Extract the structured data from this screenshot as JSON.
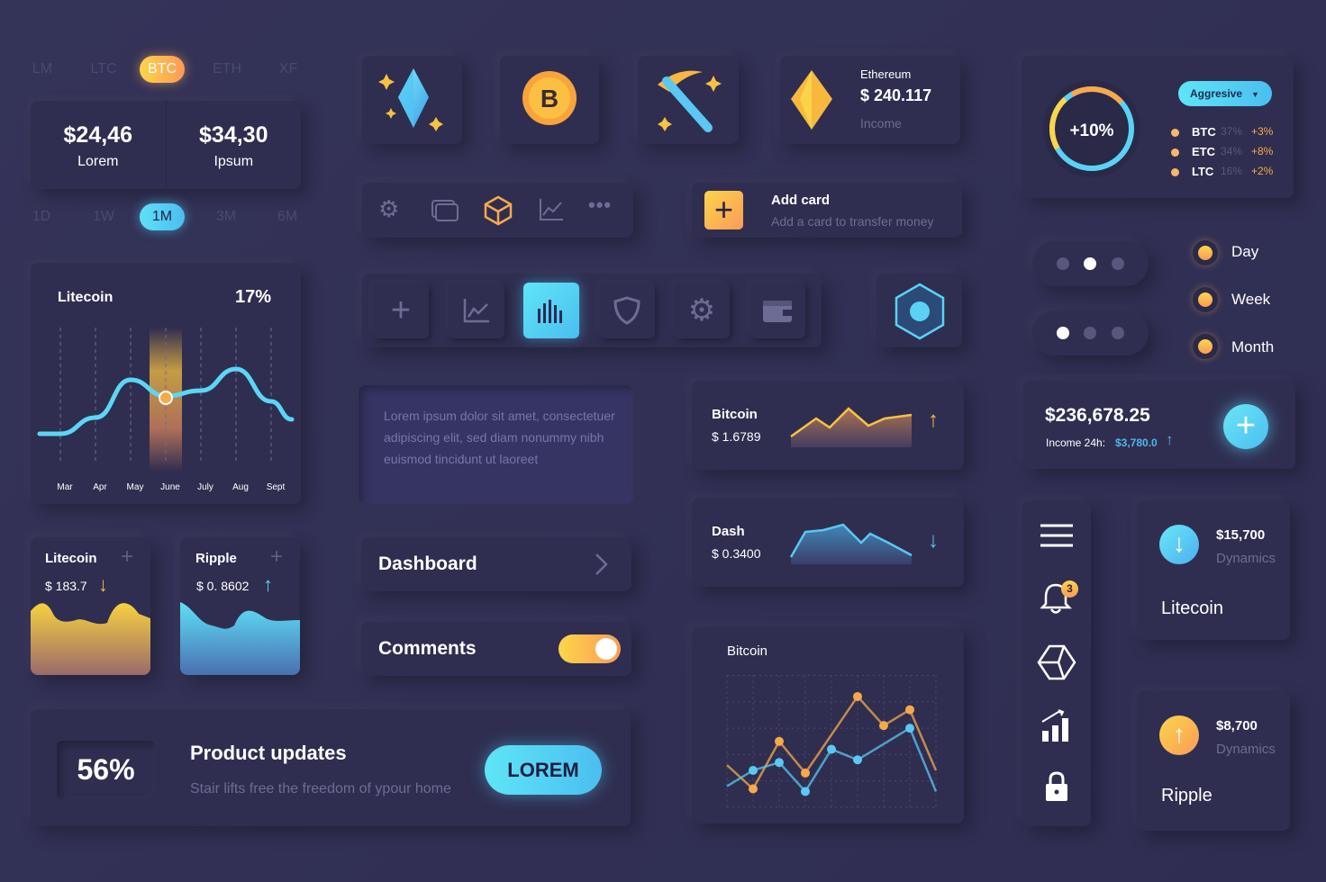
{
  "coin_tabs": {
    "items": [
      "LM",
      "LTC",
      "BTC",
      "ETH",
      "XF"
    ],
    "active": "BTC"
  },
  "prices": [
    {
      "value": "$24,46",
      "label": "Lorem"
    },
    {
      "value": "$34,30",
      "label": "Ipsum"
    }
  ],
  "period_tabs": {
    "items": [
      "1D",
      "1W",
      "1M",
      "3M",
      "6M"
    ],
    "active": "1M"
  },
  "litecoin_chart": {
    "title": "Litecoin",
    "percent": "17%"
  },
  "chart_data": [
    {
      "type": "line",
      "title": "Litecoin",
      "categories": [
        "Mar",
        "Apr",
        "May",
        "June",
        "July",
        "Aug",
        "Sept"
      ],
      "values": [
        1.0,
        1.6,
        3.0,
        2.4,
        2.6,
        3.4,
        2.2
      ],
      "highlight": "June",
      "grid": true,
      "colors": {
        "line": "#5cd6f5",
        "highlight": "#f7b548"
      }
    },
    {
      "type": "line",
      "title": "Bitcoin",
      "x": [
        0,
        1,
        2,
        3,
        4,
        5,
        6,
        7,
        8
      ],
      "series": [
        {
          "values": [
            1.6,
            0.7,
            2.5,
            1.3,
            null,
            4.2,
            3.1,
            3.7,
            1.4
          ],
          "color": "#f7a94a"
        },
        {
          "values": [
            0.8,
            1.4,
            1.7,
            0.6,
            2.2,
            1.8,
            null,
            3.0,
            0.6
          ],
          "color": "#5ac8f2"
        }
      ],
      "ylim": [
        0,
        5
      ],
      "grid": true
    }
  ],
  "mini_cards": [
    {
      "name": "Litecoin",
      "price": "$ 183.7",
      "trend": "down",
      "color": "#f7b548"
    },
    {
      "name": "Ripple",
      "price": "$ 0. 8602",
      "trend": "up",
      "color": "#5ad2f5"
    }
  ],
  "product_updates": {
    "percent": "56%",
    "title": "Product updates",
    "subtitle": "Stair lifts free the freedom of ypour home",
    "button": "LOREM"
  },
  "ethereum": {
    "name": "Ethereum",
    "value": "$ 240.117",
    "label": "Income"
  },
  "add_card": {
    "title": "Add card",
    "subtitle": "Add a card to transfer money"
  },
  "textarea": {
    "value": "Lorem ipsum dolor sit amet, consectetuer adipiscing elit, sed diam nonummy nibh euismod tincidunt ut laoreet"
  },
  "dashboard": {
    "label": "Dashboard"
  },
  "comments": {
    "label": "Comments",
    "toggle_on": true
  },
  "tickers": [
    {
      "name": "Bitcoin",
      "price": "$ 1.6789",
      "trend": "up"
    },
    {
      "name": "Dash",
      "price": "$ 0.3400",
      "trend": "down"
    }
  ],
  "bitcoin_chart": {
    "title": "Bitcoin"
  },
  "portfolio": {
    "center": "+10%",
    "dropdown": "Aggresive",
    "rows": [
      {
        "coin": "BTC",
        "share": "37%",
        "change": "+3%"
      },
      {
        "coin": "ETC",
        "share": "34%",
        "change": "+8%"
      },
      {
        "coin": "LTC",
        "share": "16%",
        "change": "+2%"
      }
    ]
  },
  "pager_dots": [
    {
      "active": 1
    },
    {
      "active": 0
    }
  ],
  "radios": [
    "Day",
    "Week",
    "Month"
  ],
  "balance": {
    "value": "$236,678.25",
    "label": "Income 24h:",
    "income": "$3,780.0"
  },
  "sidebar": {
    "notification_count": "3",
    "icons": [
      "menu-icon",
      "bell-icon",
      "cube-icon",
      "stats-icon",
      "lock-icon"
    ]
  },
  "dynamics": [
    {
      "value": "$15,700",
      "label": "Dynamics",
      "coin": "Litecoin",
      "trend": "down"
    },
    {
      "value": "$8,700",
      "label": "Dynamics",
      "coin": "Ripple",
      "trend": "up"
    }
  ],
  "colors": {
    "background": "#32315a",
    "card": "#2f2e50",
    "orange": "#fba84f",
    "blue": "#52cdf4",
    "muted": "#6d6c94"
  }
}
